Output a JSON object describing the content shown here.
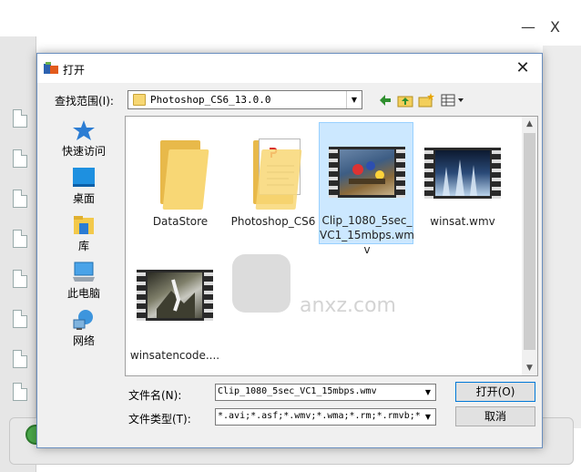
{
  "background_app": {
    "minimize_label": "—",
    "close_label": "X"
  },
  "dialog": {
    "title": "打开",
    "close_label": "✕",
    "look_in": {
      "label": "查找范围(I):",
      "value": "Photoshop_CS6_13.0.0"
    },
    "places": [
      {
        "label": "快速访问",
        "icon": "star-icon"
      },
      {
        "label": "桌面",
        "icon": "desktop-icon"
      },
      {
        "label": "库",
        "icon": "library-icon"
      },
      {
        "label": "此电脑",
        "icon": "computer-icon"
      },
      {
        "label": "网络",
        "icon": "network-icon"
      }
    ],
    "files": [
      {
        "name": "DataStore",
        "kind": "folder",
        "selected": false
      },
      {
        "name": "Photoshop_CS6",
        "kind": "folder-doc",
        "selected": false
      },
      {
        "name": "Clip_1080_5sec_VC1_15mbps.wmv",
        "kind": "video",
        "selected": true
      },
      {
        "name": "winsat.wmv",
        "kind": "video",
        "selected": false
      },
      {
        "name": "winsatencode....",
        "kind": "video",
        "selected": false
      }
    ],
    "filename": {
      "label": "文件名(N):",
      "value": "Clip_1080_5sec_VC1_15mbps.wmv"
    },
    "filetype": {
      "label": "文件类型(T):",
      "value": "*.avi;*.asf;*.wmv;*.wma;*.rm;*.rmvb;*"
    },
    "buttons": {
      "open": "打开(O)",
      "cancel": "取消"
    }
  },
  "watermark": {
    "text": "anxz.com"
  },
  "colors": {
    "selection": "#cce8ff",
    "dialog_border": "#6a8fbf",
    "folder": "#f8d775"
  }
}
